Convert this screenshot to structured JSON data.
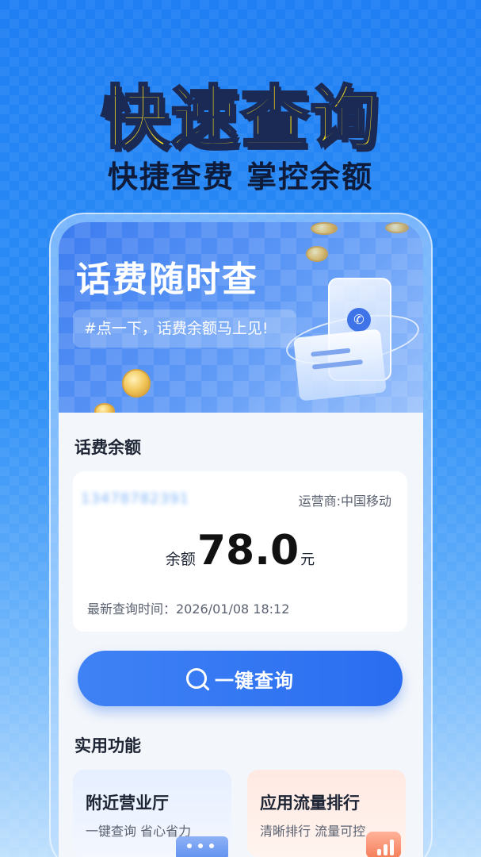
{
  "hero": {
    "title": "快速查询",
    "subtitle": "快捷查费 掌控余额"
  },
  "banner": {
    "title": "话费随时查",
    "tag": "#点一下，话费余额马上见!"
  },
  "balance_section": {
    "title": "话费余额",
    "phone_number": "13478782391",
    "carrier": "运营商:中国移动",
    "balance_label": "余额",
    "balance_value": "78.0",
    "balance_unit": "元",
    "update_time": "最新查询时间：2026/01/08 18:12"
  },
  "query_button": {
    "label": "一键查询",
    "icon": "search-icon"
  },
  "features_section": {
    "title": "实用功能",
    "items": [
      {
        "title": "附近营业厅",
        "desc": "一键查询 省心省力",
        "icon": "store-icon"
      },
      {
        "title": "应用流量排行",
        "desc": "清晰排行 流量可控",
        "icon": "bar-chart-icon"
      }
    ]
  },
  "colors": {
    "primary": "#2a6df0",
    "hero_title": "#ffe21a",
    "background": "#2e8ff6"
  }
}
